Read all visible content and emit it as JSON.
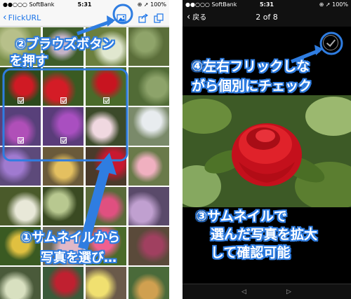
{
  "left_screen": {
    "status": {
      "carrier": "●●○○○ SoftBank",
      "time": "5:31",
      "battery": "⊕ ➚ 100%"
    },
    "nav": {
      "back_label": "FlickURL"
    },
    "icons": [
      "browse-icon",
      "share-icon",
      "copy-icon"
    ]
  },
  "right_screen": {
    "status": {
      "carrier": "●●○○○ SoftBank",
      "time": "5:31",
      "battery": "⊕ ➚ 100%"
    },
    "nav": {
      "back_label": "戻る",
      "title": "2 of 8"
    },
    "toolbar": {
      "prev": "◁",
      "next": "▷"
    }
  },
  "annotations": {
    "a2_line1": "②ブラウズボタン",
    "a2_line2": "を押す",
    "a1_line1": "①サムネイルから",
    "a1_line2": "写真を選び…",
    "a4_line1": "④左右フリックしな",
    "a4_line2": "がら個別にチェック",
    "a3_line1": "③サムネイルで",
    "a3_line2": "選んだ写真を拡大",
    "a3_line3": "して確認可能"
  },
  "colors": {
    "accent": "#2f7de1",
    "ios_blue": "#1a73e8"
  }
}
